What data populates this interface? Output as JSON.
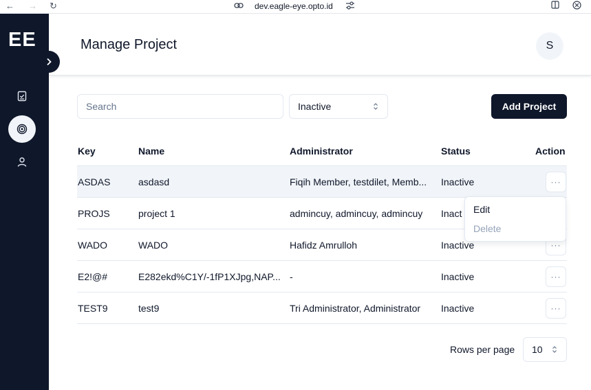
{
  "browser": {
    "url": "dev.eagle-eye.opto.id"
  },
  "sidebar": {
    "logo": "EE",
    "items": [
      {
        "name": "tasks",
        "icon": "clipboard-check-icon",
        "active": false
      },
      {
        "name": "projects",
        "icon": "target-icon",
        "active": true
      },
      {
        "name": "users",
        "icon": "user-icon",
        "active": false
      }
    ]
  },
  "header": {
    "title": "Manage Project",
    "avatar_initial": "S"
  },
  "toolbar": {
    "search_placeholder": "Search",
    "status_filter": "Inactive",
    "add_button": "Add Project"
  },
  "table": {
    "headers": {
      "key": "Key",
      "name": "Name",
      "administrator": "Administrator",
      "status": "Status",
      "action": "Action"
    },
    "rows": [
      {
        "key": "ASDAS",
        "name": "asdasd",
        "administrator": "Fiqih Member, testdilet, Memb...",
        "status": "Inactive"
      },
      {
        "key": "PROJS",
        "name": "project 1",
        "administrator": "admincuy, admincuy, admincuy",
        "status": "Inact"
      },
      {
        "key": "WADO",
        "name": "WADO",
        "administrator": "Hafidz Amrulloh",
        "status": "Inactive"
      },
      {
        "key": "E2!@#",
        "name": "E282ekd%C1Y/-1fP1XJpg,NAP...",
        "administrator": "-",
        "status": "Inactive"
      },
      {
        "key": "TEST9",
        "name": "test9",
        "administrator": "Tri Administrator, Administrator",
        "status": "Inactive"
      }
    ],
    "more_label": "···"
  },
  "action_menu": {
    "edit": "Edit",
    "delete": "Delete"
  },
  "pagination": {
    "rows_per_page_label": "Rows per page",
    "rows_per_page_value": "10"
  },
  "colors": {
    "sidebar_bg": "#0f172a",
    "primary": "#0f172a",
    "row_highlight": "#f1f5f9",
    "border": "#e2e8f0",
    "muted": "#94a3b8"
  }
}
